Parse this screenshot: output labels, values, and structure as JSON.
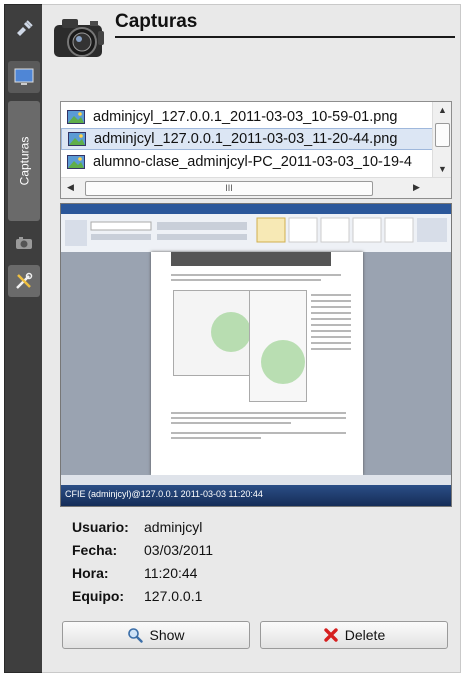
{
  "sidebar": {
    "tab_label": "Capturas"
  },
  "panel": {
    "title": "Capturas"
  },
  "file_list": {
    "items": [
      {
        "name": "adminjcyl_127.0.0.1_2011-03-03_10-59-01.png",
        "selected": false
      },
      {
        "name": "adminjcyl_127.0.0.1_2011-03-03_11-20-44.png",
        "selected": true
      },
      {
        "name": "alumno-clase_adminjcyl-PC_2011-03-03_10-19-4",
        "selected": false
      }
    ],
    "hscroll_grip": "III"
  },
  "preview": {
    "taskbar_title": "CFIE (adminjcyl)@127.0.0.1 2011-03-03 11:20:44"
  },
  "info": {
    "usuario_label": "Usuario:",
    "usuario_value": "adminjcyl",
    "fecha_label": "Fecha:",
    "fecha_value": "03/03/2011",
    "hora_label": "Hora:",
    "hora_value": "11:20:44",
    "equipo_label": "Equipo:",
    "equipo_value": "127.0.0.1"
  },
  "buttons": {
    "show_label": "Show",
    "delete_label": "Delete"
  },
  "colors": {
    "sidebar_bg": "#3e3e3e",
    "panel_bg": "#e9e9e9",
    "selection_bg": "#dce6f4",
    "delete_icon": "#d62020"
  }
}
